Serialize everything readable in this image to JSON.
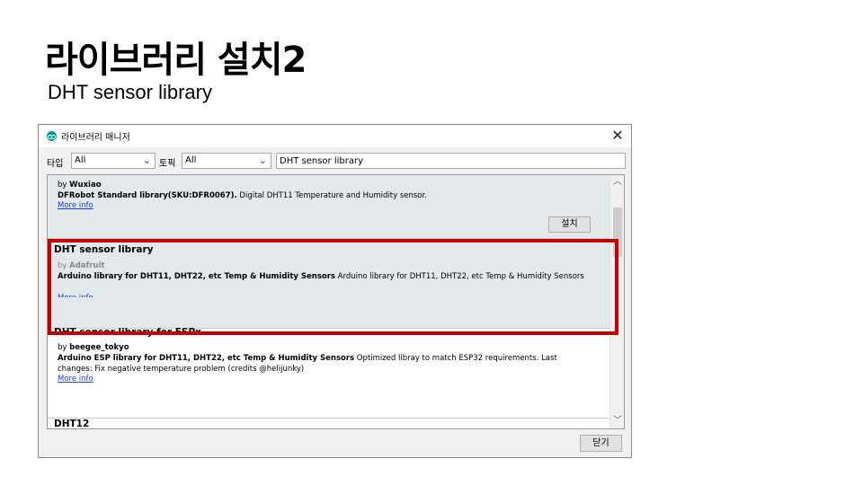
{
  "slide": {
    "title": "라이브러리 설치2",
    "subtitle": "DHT sensor library"
  },
  "window": {
    "title": "라이브러리 매니저",
    "close_label": "✕",
    "icon": "arduino-icon"
  },
  "filters": {
    "type_label": "타입",
    "type_value": "All",
    "topic_label": "토픽",
    "topic_value": "All",
    "search_value": "DHT sensor library"
  },
  "libraries": [
    {
      "by_prefix": "by",
      "author": "Wuxiao",
      "desc_bold": "DFRobot Standard library(SKU:DFR0067).",
      "desc": " Digital DHT11 Temperature and Humidity sensor.",
      "more_info": "More info",
      "install_label": "설치"
    },
    {
      "name": "DHT sensor library",
      "by_prefix": "by",
      "author": "Adafruit",
      "desc_bold": "Arduino library for DHT11, DHT22, etc Temp & Humidity Sensors",
      "desc": " Arduino library for DHT11, DHT22, etc Temp & Humidity Sensors",
      "more_info": "More info"
    },
    {
      "name": "DHT sensor library for ESPx",
      "by_prefix": "by",
      "author": "beegee_tokyo",
      "desc_bold": "Arduino ESP library for DHT11, DHT22, etc Temp & Humidity Sensors",
      "desc": " Optimized libray to match ESP32 requirements. Last changes: Fix negative temperature problem (credits @helijunky)",
      "more_info": "More info"
    },
    {
      "name": "DHT12"
    }
  ],
  "footer": {
    "close_label": "닫기"
  },
  "colors": {
    "highlight": "#c00000",
    "selected_row": "#e3e8ea",
    "link": "#1a3fc4"
  }
}
